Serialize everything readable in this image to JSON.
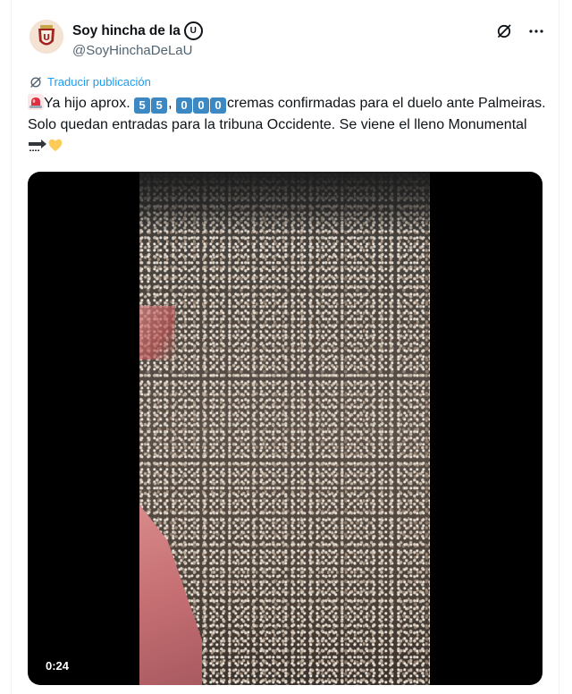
{
  "user": {
    "display_name": "Soy hincha de la",
    "badge_letter": "U",
    "handle": "@SoyHinchaDeLaU"
  },
  "icons": {
    "grok": "grok-icon",
    "more": "more-icon",
    "translate": "translate-icon",
    "siren": "police-light-emoji",
    "soon": "soon-arrow-emoji",
    "heart": "yellow-heart-emoji"
  },
  "translate_label": "Traducir publicación",
  "post": {
    "part1": "Ya hijo aprox. ",
    "digits_a": [
      "5",
      "5"
    ],
    "comma": ",",
    "digits_b": [
      "0",
      "0",
      "0"
    ],
    "part2": "cremas confirmadas para el duelo ante Palmeiras. Solo quedan entradas para la tribuna Occidente. Se viene el lleno Monumental"
  },
  "video": {
    "duration": "0:24"
  },
  "colors": {
    "link": "#1d9bf0",
    "keycap": "#3b88c3",
    "text": "#0f1419",
    "muted": "#536471"
  }
}
